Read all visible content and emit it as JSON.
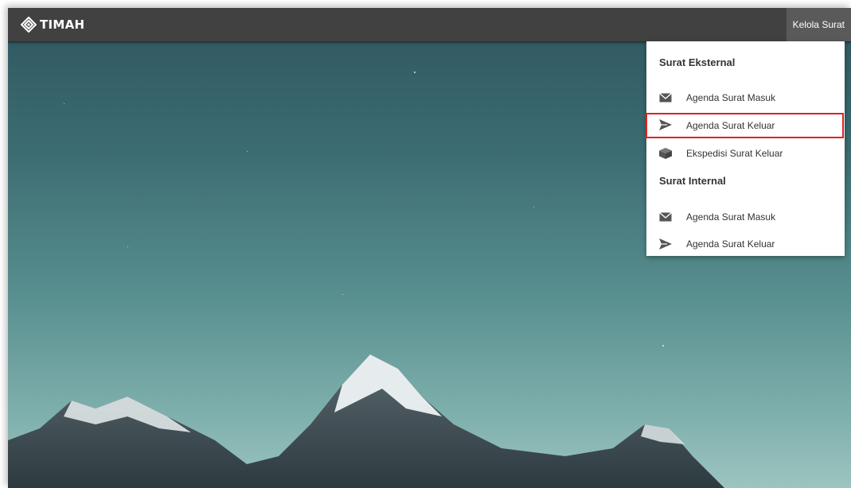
{
  "header": {
    "logo_text": "TIMAH",
    "nav_button_label": "Kelola Surat"
  },
  "dropdown": {
    "sections": [
      {
        "title": "Surat Eksternal",
        "items": [
          {
            "label": "Agenda Surat Masuk",
            "icon": "envelope-icon"
          },
          {
            "label": "Agenda Surat Keluar",
            "icon": "paper-plane-icon",
            "highlighted": true
          },
          {
            "label": "Ekspedisi Surat Keluar",
            "icon": "cube-icon"
          }
        ]
      },
      {
        "title": "Surat Internal",
        "items": [
          {
            "label": "Agenda Surat Masuk",
            "icon": "envelope-icon"
          },
          {
            "label": "Agenda Surat Keluar",
            "icon": "paper-plane-icon"
          }
        ]
      }
    ]
  },
  "colors": {
    "topbar": "#414141",
    "nav_button": "#5a5a5a",
    "highlight_border": "#e02020",
    "menu_icon": "#555555"
  }
}
